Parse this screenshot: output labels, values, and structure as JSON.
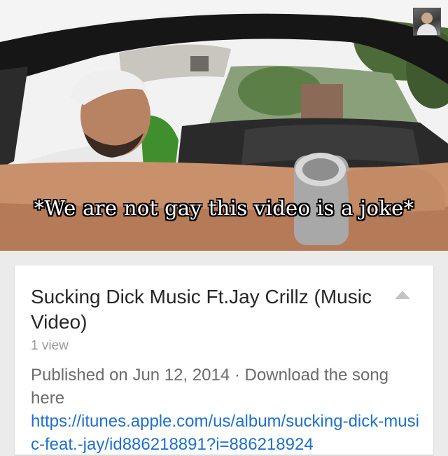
{
  "video": {
    "caption": "*We are not gay this video is a joke*"
  },
  "card": {
    "title": "Sucking Dick Music Ft.Jay Crillz (Music Video)",
    "views": "1 view",
    "published": "Published on Jun 12, 2014 · Download the song here",
    "link": "https://itunes.apple.com/us/album/sucking-dick-music-feat.-jay/id886218891?i=886218924"
  },
  "colors": {
    "link": "#1e6fd0",
    "title": "#262626",
    "meta": "#9a9a9a",
    "background": "#ebebeb"
  },
  "icons": {
    "collapse": "triangle-up-icon",
    "channel": "channel-avatar-icon"
  }
}
